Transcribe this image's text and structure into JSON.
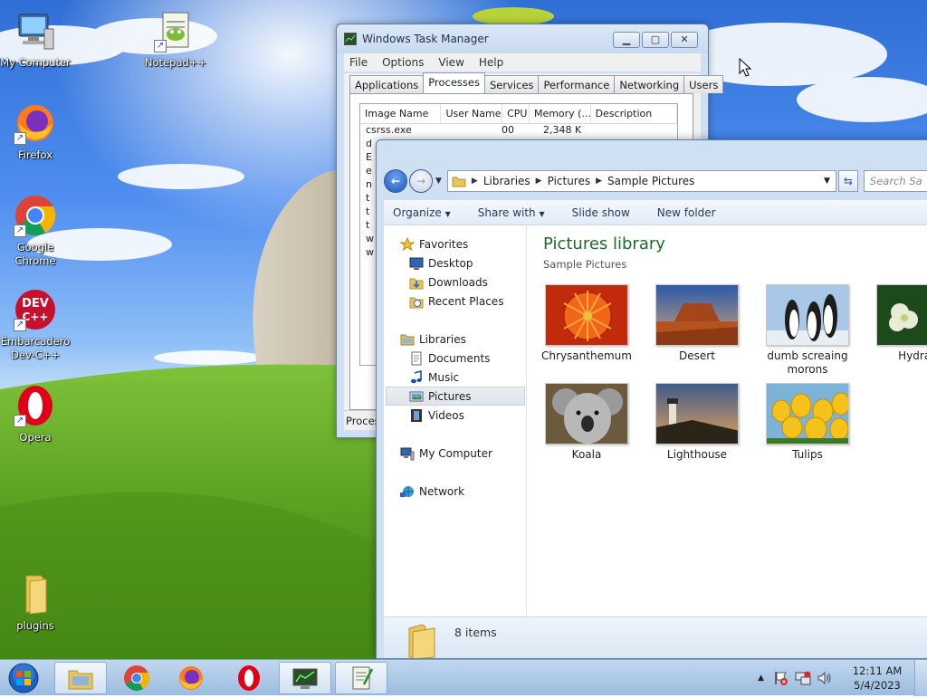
{
  "desktop": {
    "icons": [
      {
        "label": "My Computer"
      },
      {
        "label": "Notepad++"
      },
      {
        "label": "Firefox"
      },
      {
        "label": "Google Chrome"
      },
      {
        "label": "Embarcadero Dev-C++"
      },
      {
        "label": "Opera"
      },
      {
        "label": "plugins"
      }
    ]
  },
  "task_manager": {
    "title": "Windows Task Manager",
    "menu": [
      "File",
      "Options",
      "View",
      "Help"
    ],
    "tabs": [
      "Applications",
      "Processes",
      "Services",
      "Performance",
      "Networking",
      "Users"
    ],
    "active_tab": "Processes",
    "columns": [
      "Image Name",
      "User Name",
      "CPU",
      "Memory (...",
      "Description"
    ],
    "first_row": {
      "image": "csrss.exe",
      "cpu": "00",
      "memory": "2,348 K"
    },
    "row_initials": [
      "d",
      "E",
      "e",
      "n",
      "t",
      "t",
      "t",
      "w",
      "w"
    ],
    "status": "Proces"
  },
  "explorer": {
    "breadcrumb": [
      "Libraries",
      "Pictures",
      "Sample Pictures"
    ],
    "search_placeholder": "Search Sa",
    "toolbar": {
      "organize": "Organize",
      "share_with": "Share with",
      "slide_show": "Slide show",
      "new_folder": "New folder"
    },
    "nav": {
      "favorites": "Favorites",
      "favorites_items": [
        "Desktop",
        "Downloads",
        "Recent Places"
      ],
      "libraries": "Libraries",
      "libraries_items": [
        "Documents",
        "Music",
        "Pictures",
        "Videos"
      ],
      "selected": "Pictures",
      "computer": "My Computer",
      "network": "Network"
    },
    "library_title": "Pictures library",
    "library_subtitle": "Sample Pictures",
    "items": [
      {
        "name": "Chrysanthemum"
      },
      {
        "name": "Desert"
      },
      {
        "name": "dumb screaing morons"
      },
      {
        "name": "Hydran"
      },
      {
        "name": "Koala"
      },
      {
        "name": "Lighthouse"
      },
      {
        "name": "Tulips"
      }
    ],
    "item_count": "8 items"
  },
  "taskbar": {
    "clock_time": "12:11 AM",
    "clock_date": "5/4/2023"
  }
}
